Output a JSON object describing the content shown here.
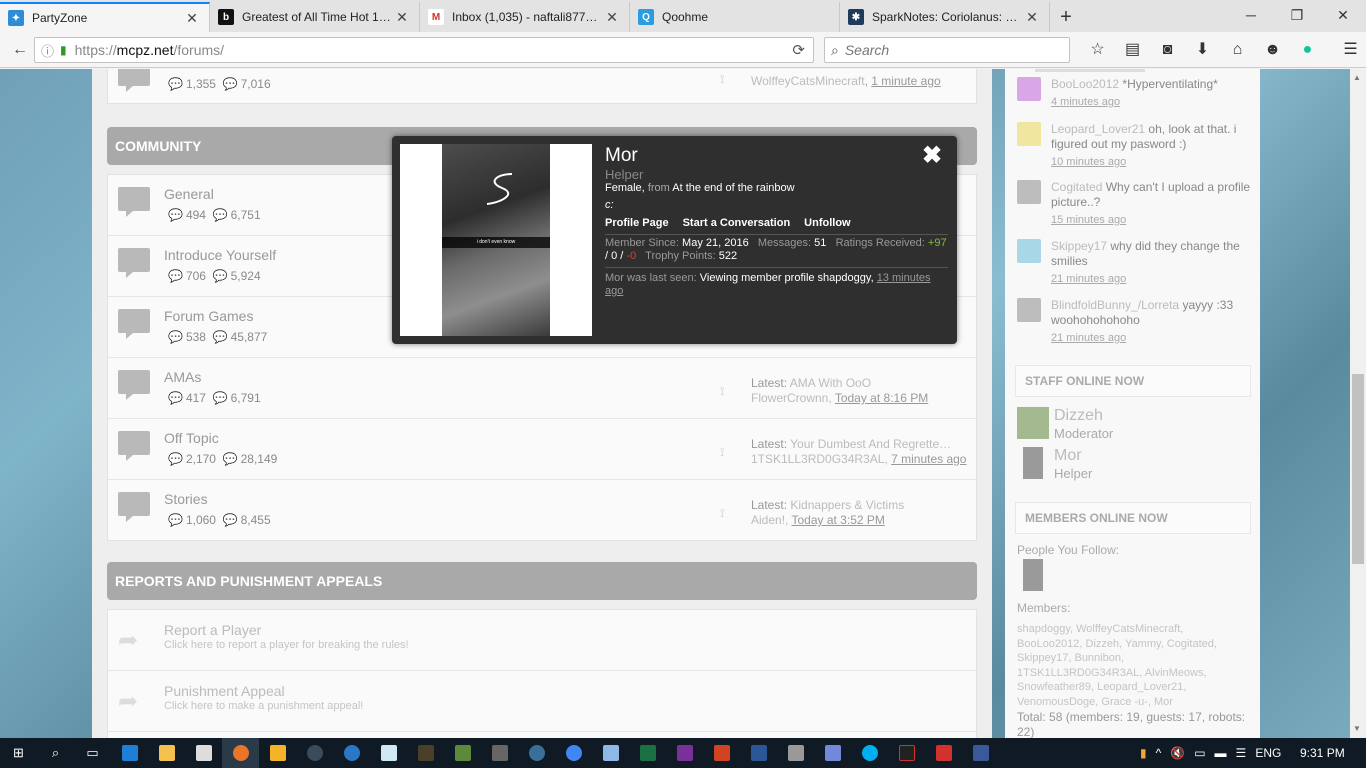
{
  "tabs": [
    {
      "label": "PartyZone",
      "icon": "partyzone-icon",
      "color": "#2f8bd6",
      "glyph": "✦",
      "active": true
    },
    {
      "label": "Greatest of All Time Hot 1…",
      "icon": "billboard-icon",
      "color": "#111111",
      "glyph": "b",
      "active": false
    },
    {
      "label": "Inbox (1,035) - naftali8778…",
      "icon": "gmail-icon",
      "color": "#d93025",
      "glyph": "M",
      "active": false
    },
    {
      "label": "Qoohme",
      "icon": "qoohme-icon",
      "color": "#2a9de0",
      "glyph": "Q",
      "active": false
    },
    {
      "label": "SparkNotes: Coriolanus: C…",
      "icon": "sparknotes-icon",
      "color": "#1f3b5a",
      "glyph": "✱",
      "active": false
    }
  ],
  "url": "https://mcpz.net/forums/",
  "url_host": "mcpz.net",
  "url_prefix": "https://",
  "url_path": "/forums/",
  "search_placeholder": "Search",
  "top_partial": {
    "threads": "1,355",
    "messages": "7,016",
    "latest_user": "WolffeyCatsMinecraft",
    "latest_time": "1 minute ago"
  },
  "community": {
    "heading": "COMMUNITY",
    "forums": [
      {
        "title": "General",
        "threads": "494",
        "messages": "6,751",
        "latest_label": "",
        "latest_title": "",
        "latest_user": "",
        "latest_time": ""
      },
      {
        "title": "Introduce Yourself",
        "threads": "706",
        "messages": "5,924",
        "latest_label": "",
        "latest_title": "",
        "latest_user": "",
        "latest_time": ""
      },
      {
        "title": "Forum Games",
        "threads": "538",
        "messages": "45,877",
        "latest_label": "",
        "latest_title": "",
        "latest_user": "",
        "latest_time": ""
      },
      {
        "title": "AMAs",
        "threads": "417",
        "messages": "6,791",
        "latest_label": "Latest:",
        "latest_title": "AMA With OoO",
        "latest_user": "FlowerCrownn,",
        "latest_time": "Today at 8:16 PM"
      },
      {
        "title": "Off Topic",
        "threads": "2,170",
        "messages": "28,149",
        "latest_label": "Latest:",
        "latest_title": "Your Dumbest And Regrette…",
        "latest_user": "1TSK1LL3RD0G34R3AL,",
        "latest_time": "7 minutes ago"
      },
      {
        "title": "Stories",
        "threads": "1,060",
        "messages": "8,455",
        "latest_label": "Latest:",
        "latest_title": "Kidnappers & Victims",
        "latest_user": "Aiden!,",
        "latest_time": "Today at 3:52 PM"
      }
    ]
  },
  "reports": {
    "heading": "REPORTS AND PUNISHMENT APPEALS",
    "links": [
      {
        "title": "Report a Player",
        "desc": "Click here to report a player for breaking the rules!"
      },
      {
        "title": "Punishment Appeal",
        "desc": "Click here to make a punishment appeal!"
      }
    ]
  },
  "shoutbox": [
    {
      "user": "BooLoo2012",
      "text": "*Hyperventilating*",
      "time": "4 minutes ago",
      "avatar_color": "#d9a7e8"
    },
    {
      "user": "Leopard_Lover21",
      "text": "oh, look at that. i figured out my pasword :)",
      "time": "10 minutes ago",
      "avatar_color": "#f0e6a0"
    },
    {
      "user": "Cogitated",
      "text": "Why can't I upload a profile picture..?",
      "time": "15 minutes ago",
      "avatar_color": "#bdbdbd"
    },
    {
      "user": "Skippey17",
      "text": "why did they change the smilies",
      "time": "21 minutes ago",
      "avatar_color": "#a8d8e8"
    },
    {
      "user": "BlindfoldBunny_/Lorreta",
      "text": "yayyy :33 woohohohohoho",
      "time": "21 minutes ago",
      "avatar_color": "#bdbdbd"
    }
  ],
  "staff_heading": "STAFF ONLINE NOW",
  "staff": [
    {
      "name": "Dizzeh",
      "role": "Moderator",
      "avatar_color": "#a4b98f"
    },
    {
      "name": "Mor",
      "role": "Helper",
      "avatar_color": "#9a9a9a"
    }
  ],
  "members_heading": "MEMBERS ONLINE NOW",
  "people_you_follow_label": "People You Follow:",
  "members_label": "Members:",
  "members": "shapdoggy, WolffeyCatsMinecraft, BooLoo2012, Dizzeh, Yammy, Cogitated, Skippey17, Bunnibon, 1TSK1LL3RD0G34R3AL, AlvinMeows, Snowfeather89, Leopard_Lover21, VenomousDoge, Grace -u-, Mor",
  "total": "Total: 58 (members: 19, guests: 17, robots: 22)",
  "popup": {
    "name": "Mor",
    "title": "Helper",
    "gender": "Female,",
    "from_label": "from",
    "location": "At the end of the rainbow",
    "status": "c:",
    "photo_caption": "i don't even know",
    "links": [
      "Profile Page",
      "Start a Conversation",
      "Unfollow"
    ],
    "member_since_label": "Member Since:",
    "member_since": "May 21, 2016",
    "messages_label": "Messages:",
    "messages": "51",
    "ratings_label": "Ratings Received:",
    "ratings_pos": "+97",
    "ratings_neutral": "/ 0 /",
    "ratings_neg": "-0",
    "trophy_label": "Trophy Points:",
    "trophy": "522",
    "last_seen_label": "Mor was last seen:",
    "last_seen_activity": "Viewing member profile shapdoggy,",
    "last_seen_time": "13 minutes ago"
  },
  "taskbar": {
    "lang": "ENG",
    "time": "9:31 PM"
  }
}
